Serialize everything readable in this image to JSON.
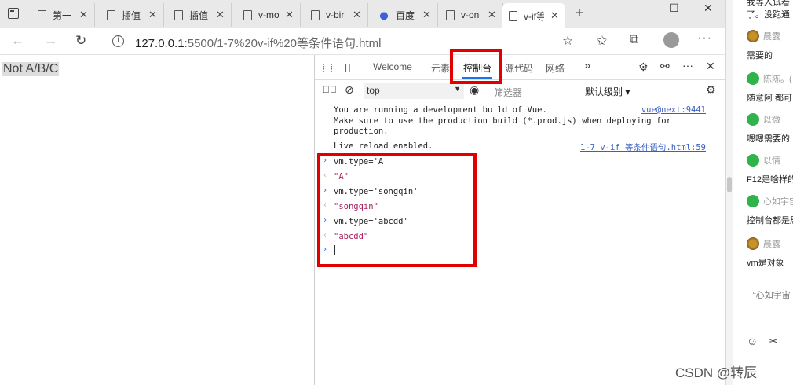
{
  "tabs": [
    {
      "label": "第一",
      "icon": "page-icon"
    },
    {
      "label": "插值",
      "icon": "page-icon"
    },
    {
      "label": "插值",
      "icon": "page-icon"
    },
    {
      "label": "v-mo",
      "icon": "page-icon"
    },
    {
      "label": "v-bir",
      "icon": "page-icon"
    },
    {
      "label": "百度",
      "icon": "baidu-icon"
    },
    {
      "label": "v-on",
      "icon": "page-icon"
    },
    {
      "label": "v-if等",
      "icon": "page-icon",
      "active": true
    }
  ],
  "window_controls": {
    "minimize": "—",
    "maximize": "☐",
    "close": "✕"
  },
  "address": {
    "host": "127.0.0.1",
    "path": ":5500/1-7%20v-if%20等条件语句.html"
  },
  "page": {
    "output": "Not A/B/C"
  },
  "devtools": {
    "tabs": [
      "Welcome",
      "元素",
      "控制台",
      "源代码",
      "网络"
    ],
    "active_tab": "控制台",
    "more": "»",
    "context": "top",
    "filter_placeholder": "筛选器",
    "level": "默认级别 ▾",
    "console": {
      "vue_msg": "You are running a development build of Vue.\nMake sure to use the production build (*.prod.js) when deploying for\nproduction.",
      "vue_src": "vue@next:9441",
      "reload_msg": "Live reload enabled.",
      "reload_src": "1-7 v-if 等条件语句.html:59",
      "entries": [
        {
          "type": "in",
          "text": "vm.type='A'"
        },
        {
          "type": "out",
          "text": "\"A\""
        },
        {
          "type": "in",
          "text": "vm.type='songqin'"
        },
        {
          "type": "out",
          "text": "\"songqin\""
        },
        {
          "type": "in",
          "text": "vm.type='abcdd'"
        },
        {
          "type": "out",
          "text": "\"abcdd\""
        }
      ]
    }
  },
  "side_panel": {
    "top_text": "我等人试着",
    "top_text2": "了。没跑通",
    "chat": [
      {
        "user": "晨露",
        "avatar": "gold",
        "msg": "需要的"
      },
      {
        "user": "陈陈。(",
        "avatar": "green",
        "msg": "随意阿 都可"
      },
      {
        "user": "以微",
        "avatar": "green",
        "msg": "嗯嗯需要的"
      },
      {
        "user": "以情",
        "avatar": "green",
        "msg": "F12是啥样的"
      },
      {
        "user": "心如宇宙",
        "avatar": "green",
        "msg": "控制台都是局"
      },
      {
        "user": "晨露",
        "avatar": "gold",
        "msg": "vm是对象"
      }
    ],
    "quote": "“心如宇宙",
    "icons": [
      "smile-icon",
      "scissors-icon"
    ]
  },
  "watermark": "CSDN @转辰"
}
